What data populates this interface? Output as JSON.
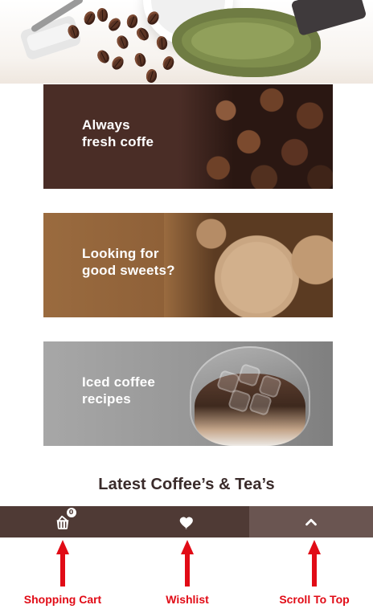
{
  "banners": [
    {
      "label": "Always\nfresh coffe"
    },
    {
      "label": "Looking for\ngood sweets?"
    },
    {
      "label": "Iced coffee\nrecipes"
    }
  ],
  "section": {
    "title": "Latest Coffee’s & Tea’s"
  },
  "bottom_bar": {
    "cart": {
      "icon": "shopping-cart-icon",
      "count": "0"
    },
    "wishlist": {
      "icon": "heart-icon"
    },
    "scroll_top": {
      "icon": "chevron-up-icon"
    }
  },
  "annotations": [
    {
      "label": "Shopping Cart"
    },
    {
      "label": "Wishlist"
    },
    {
      "label": "Scroll To Top"
    }
  ],
  "colors": {
    "bar_primary": "#4f3a35",
    "bar_secondary": "#6a5551",
    "annotation_red": "#e10b16",
    "title_text": "#3a2b2a",
    "banner_text": "#ffffff"
  }
}
